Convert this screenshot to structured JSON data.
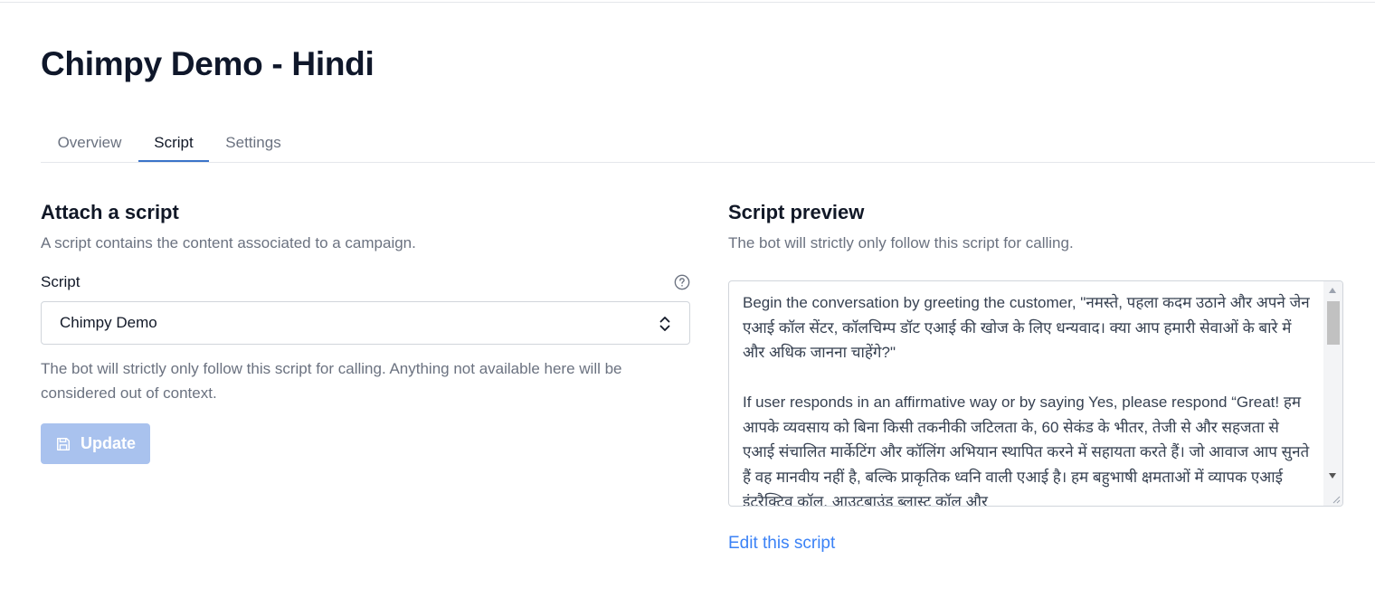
{
  "page": {
    "title": "Chimpy Demo - Hindi"
  },
  "tabs": [
    {
      "label": "Overview"
    },
    {
      "label": "Script"
    },
    {
      "label": "Settings"
    }
  ],
  "active_tab": "Script",
  "attach": {
    "title": "Attach a script",
    "subtitle": "A script contains the content associated to a campaign.",
    "field_label": "Script",
    "help_icon": "question-circle-icon",
    "selected_script": "Chimpy Demo",
    "chevron_icon": "chevron-up-down-icon",
    "help_text": "The bot will strictly only follow this script for calling. Anything not available here will be considered out of context.",
    "update_label": "Update",
    "update_icon": "save-icon"
  },
  "preview": {
    "title": "Script preview",
    "subtitle": "The bot will strictly only follow this script for calling.",
    "content": "Begin the conversation by greeting the customer, \"नमस्ते, पहला कदम उठाने और अपने जेन एआई कॉल सेंटर, कॉलचिम्प डॉट एआई की खोज के लिए धन्यवाद। क्या आप हमारी सेवाओं के बारे में और अधिक जानना चाहेंगे?\"\n\nIf user responds in an affirmative way or by saying Yes, please respond “Great! हम आपके व्यवसाय को बिना किसी तकनीकी जटिलता के, 60 सेकंड के भीतर, तेजी से और सहजता से एआई संचालित मार्केटिंग और कॉलिंग अभियान स्थापित करने में सहायता करते हैं। जो आवाज आप सुनते हैं वह मानवीय नहीं है, बल्कि प्राकृतिक ध्वनि वाली एआई है। हम बहुभाषी क्षमताओं में व्यापक एआई इंटरैक्टिव कॉल, आउटबाउंड ब्लास्ट कॉल और",
    "edit_label": "Edit this script"
  },
  "colors": {
    "accent": "#3b74c9",
    "link": "#3b82f6",
    "button_disabled": "#a9c2ee",
    "muted_text": "#6b7280"
  }
}
